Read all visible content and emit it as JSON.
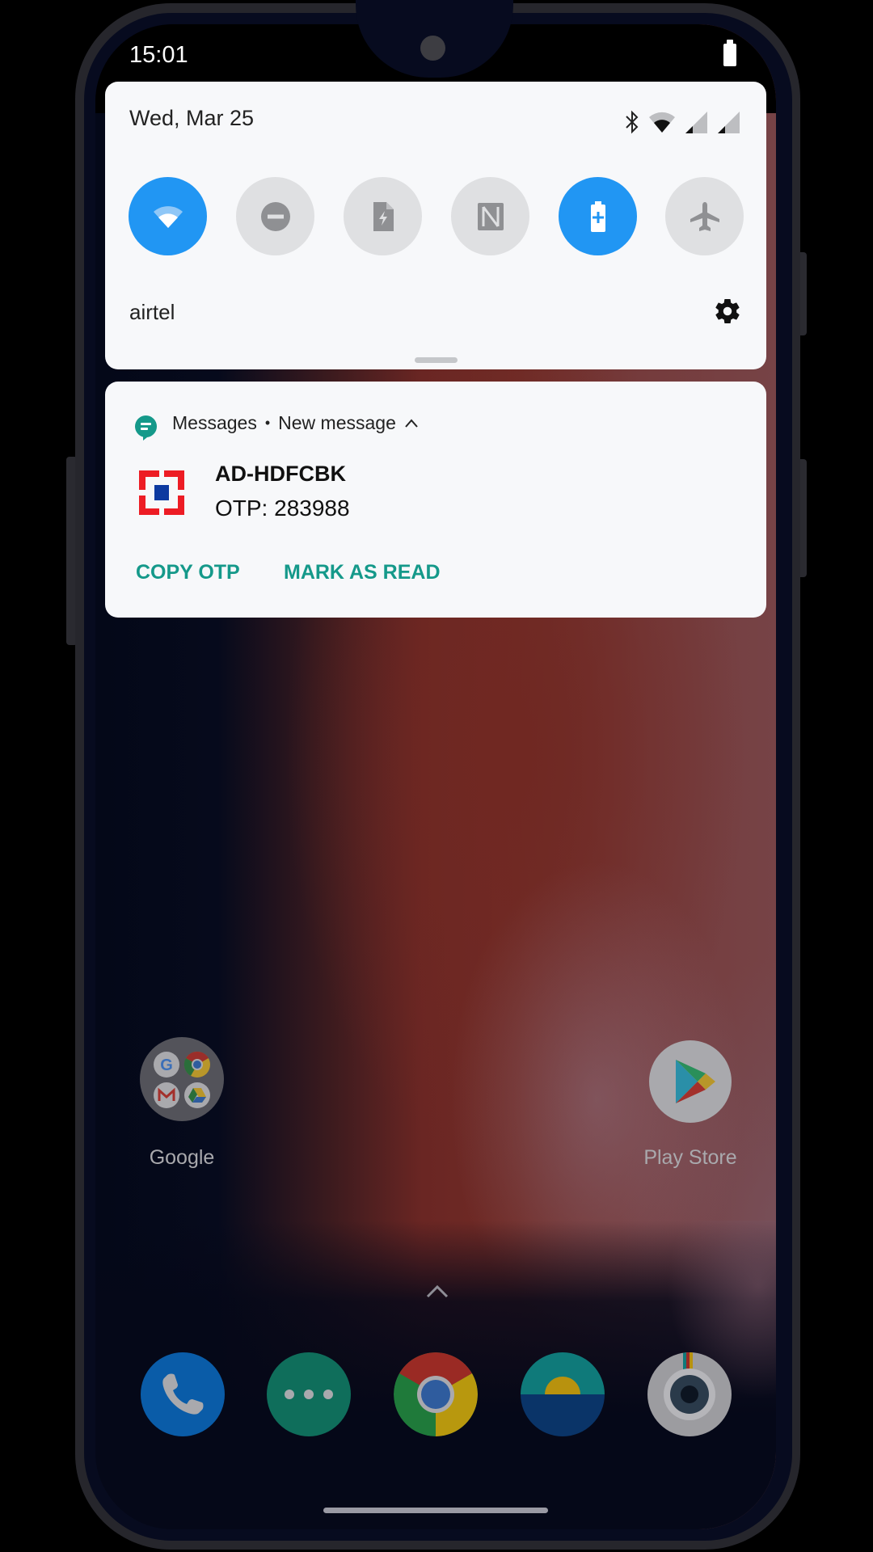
{
  "status_bar": {
    "time": "15:01",
    "battery_icon": "battery-full-icon"
  },
  "quick_settings": {
    "date": "Wed, Mar 25",
    "status_icons": [
      "bluetooth-icon",
      "wifi-signal-icon",
      "cell-signal-icon-sim1",
      "cell-signal-icon-sim2"
    ],
    "tiles": [
      {
        "name": "wifi",
        "icon": "wifi-icon",
        "active": true
      },
      {
        "name": "do-not-disturb",
        "icon": "do-not-disturb-icon",
        "active": false
      },
      {
        "name": "battery-saver-file",
        "icon": "flash-file-icon",
        "active": false
      },
      {
        "name": "nfc",
        "icon": "nfc-icon",
        "active": false
      },
      {
        "name": "battery-saver",
        "icon": "battery-plus-icon",
        "active": true
      },
      {
        "name": "airplane-mode",
        "icon": "airplane-icon",
        "active": false
      }
    ],
    "carrier": "airtel",
    "settings_icon": "gear-icon",
    "colors": {
      "active_tile": "#2196f3",
      "inactive_tile": "#dfe0e2",
      "inactive_glyph": "#8f9093"
    }
  },
  "notification": {
    "app_name": "Messages",
    "separator": "•",
    "subtext": "New message",
    "sender": "AD-HDFCBK",
    "body": "OTP: 283988",
    "actions": [
      {
        "label": "COPY OTP"
      },
      {
        "label": "MARK AS READ"
      }
    ],
    "colors": {
      "accent": "#15998a",
      "app_icon": "#15998a"
    }
  },
  "home": {
    "apps": [
      {
        "label": "Google",
        "type": "folder"
      },
      {
        "label": "Play Store",
        "type": "app"
      }
    ],
    "dock": [
      {
        "name": "phone",
        "icon": "phone-icon",
        "color": "#0a5ca8"
      },
      {
        "name": "messages",
        "icon": "chat-dots-icon",
        "color": "#0f6e5b"
      },
      {
        "name": "chrome",
        "icon": "chrome-icon"
      },
      {
        "name": "gallery",
        "icon": "gallery-sunrise-icon"
      },
      {
        "name": "camera",
        "icon": "camera-icon"
      }
    ]
  }
}
